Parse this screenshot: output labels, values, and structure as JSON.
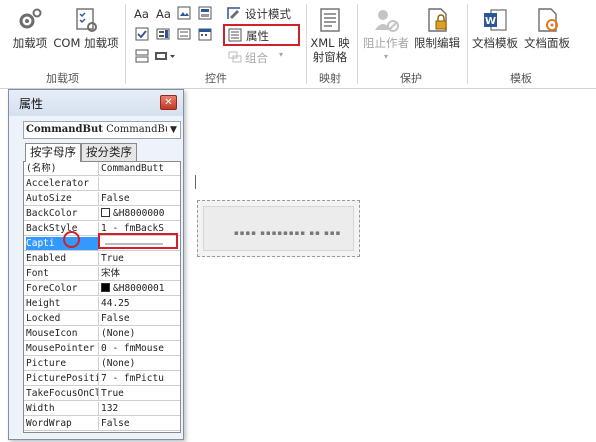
{
  "ribbon": {
    "groups": [
      {
        "label": "加载项"
      },
      {
        "label": "控件"
      },
      {
        "label": "映射"
      },
      {
        "label": "保护"
      },
      {
        "label": "模板"
      }
    ],
    "addins_button": "加载项",
    "com_addins_button": "COM 加载项",
    "design_mode": "设计模式",
    "properties": "属性",
    "combine": "组合",
    "xml_mapping_line1": "XML 映",
    "xml_mapping_line2": "射窗格",
    "block_authors": "阻止作者",
    "restrict_editing": "限制编辑",
    "document_template": "文档模板",
    "document_panel": "文档面板",
    "aa_label_1": "Aa",
    "aa_label_2": "Aa"
  },
  "properties_window": {
    "title": "属性",
    "object_name": "CommandBut",
    "object_type": "CommandBut",
    "tab_alphabetic": "按字母序",
    "tab_categorized": "按分类序",
    "rows": [
      {
        "name": "(名称)",
        "value": "CommandButt"
      },
      {
        "name": "Accelerator",
        "value": ""
      },
      {
        "name": "AutoSize",
        "value": "False"
      },
      {
        "name": "BackColor",
        "value": "&H8000000"
      },
      {
        "name": "BackStyle",
        "value": "1 - fmBackS"
      },
      {
        "name": "Capti",
        "value": ""
      },
      {
        "name": "Enabled",
        "value": "True"
      },
      {
        "name": "Font",
        "value": "宋体"
      },
      {
        "name": "ForeColor",
        "value": "&H8000001"
      },
      {
        "name": "Height",
        "value": "44.25"
      },
      {
        "name": "Locked",
        "value": "False"
      },
      {
        "name": "MouseIcon",
        "value": "(None)"
      },
      {
        "name": "MousePointer",
        "value": "0 - fmMouse"
      },
      {
        "name": "Picture",
        "value": "(None)"
      },
      {
        "name": "PicturePositi",
        "value": "7 - fmPictu"
      },
      {
        "name": "TakeFocusOnCl",
        "value": "True"
      },
      {
        "name": "Width",
        "value": "132"
      },
      {
        "name": "WordWrap",
        "value": "False"
      }
    ]
  },
  "colors": {
    "highlight": "#d2202a",
    "selection": "#3399ff",
    "word_blue": "#2b579a"
  }
}
